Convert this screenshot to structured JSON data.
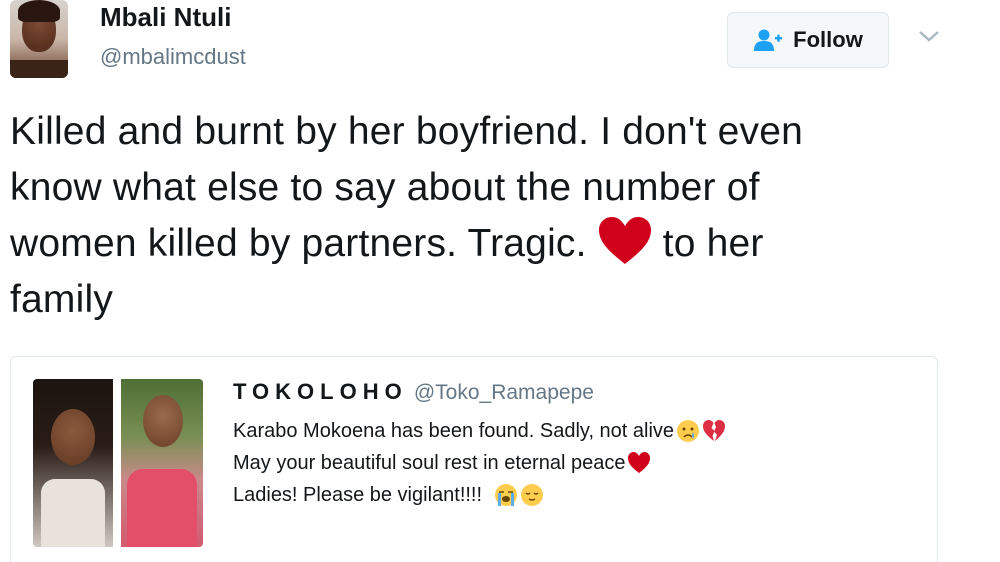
{
  "author": {
    "name": "Mbali Ntuli",
    "handle": "@mbalimcdust"
  },
  "actions": {
    "follow_label": "Follow",
    "follow_icon": "add-user-icon",
    "menu_icon": "chevron-down-icon"
  },
  "tweet": {
    "line1": "Killed and burnt by her boyfriend. I don't even",
    "line2": "know what else to say about the number of",
    "line3_before": "women killed by partners. Tragic.",
    "line3_emoji": "red-heart-icon",
    "line3_after": "to her",
    "line4": "family"
  },
  "quote": {
    "name": "TOKOLOHO",
    "handle": "@Toko_Ramapepe",
    "lines": [
      {
        "text": "Karabo Mokoena has been found. Sadly, not alive",
        "emojis": [
          "crying-face-icon",
          "broken-heart-icon"
        ]
      },
      {
        "text": "May your beautiful soul rest in eternal peace",
        "emojis": [
          "red-heart-icon"
        ]
      },
      {
        "text": "Ladies! Please be vigilant!!!!",
        "emojis": [
          "loudly-crying-face-icon",
          "relieved-face-icon"
        ]
      }
    ]
  },
  "colors": {
    "text": "#14171a",
    "secondary": "#657786",
    "border": "#e1e8ed",
    "follow_icon": "#1da1f2",
    "heart": "#d0021b"
  }
}
